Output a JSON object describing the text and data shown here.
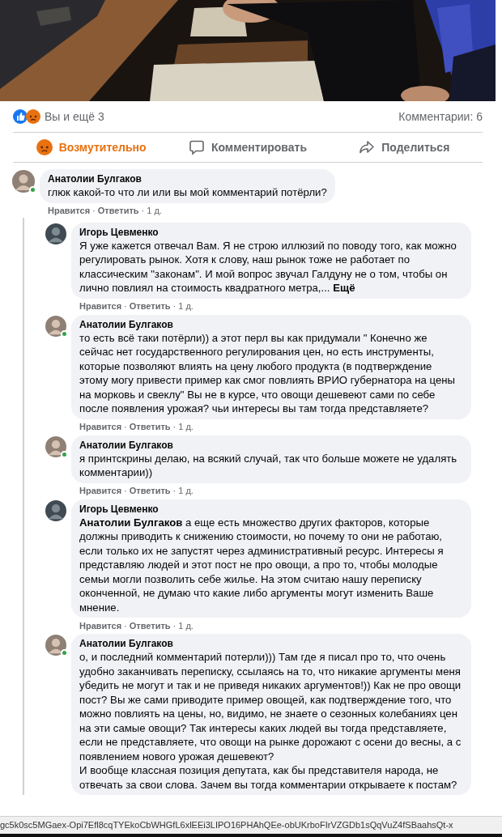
{
  "meta_separator": "·",
  "reactions": {
    "summary": "Вы и ещё 3",
    "comments_count": "Комментарии: 6"
  },
  "actions": [
    {
      "kind": "angry",
      "label": "Возмутительно",
      "selected": true
    },
    {
      "kind": "comment",
      "label": "Комментировать",
      "selected": false
    },
    {
      "kind": "share",
      "label": "Поделиться",
      "selected": false
    }
  ],
  "comments": [
    {
      "author": "Анатолии Булгаков",
      "online": true,
      "text": "глюк какой-то что ли или вы мой комментарий потёрли?",
      "like": "Нравится",
      "reply": "Ответить",
      "time": "1 д.",
      "children": [
        {
          "author": "Игорь Цевменко",
          "online": false,
          "text": "Я уже кажется отвечал Вам. Я не строю иллюзий по поводу того, как можно регулировать рынок. Хотя к слову, наш рынок тоже не работает по классическим \"законам\". И мой вопрос звучал Галдуну не о том, чтобы он лично повлиял на стоимость квадратного метра,...",
          "more": "Ещё",
          "like": "Нравится",
          "reply": "Ответить",
          "time": "1 д."
        },
        {
          "author": "Анатолии Булгаков",
          "online": true,
          "text": "то есть всё таки потёрли)) а этот перл вы как придумали \" Конечно же сейчас нет государственного регулирования цен, но есть инструменты, которые позволяют влиять на цену любого продукта (в подтверждение этому могу привести пример как смог повлиять ВРИО губернатора на цены на морковь и свеклу\" Вы не в курсе, что овощи дешевеют сами по себе после появления урожая? чьи интересы вы там тогда представляете?",
          "like": "Нравится",
          "reply": "Ответить",
          "time": "1 д."
        },
        {
          "author": "Анатолии Булгаков",
          "online": true,
          "text": "я принтскрины делаю, на всякий случай, так что больше можете не удалять комментарии))",
          "like": "Нравится",
          "reply": "Ответить",
          "time": "1 д."
        },
        {
          "author": "Игорь Цевменко",
          "online": false,
          "text": "**Анатолии Булгаков** а еще есть множество других факторов, которые должны приводить к снижению стоимости, но почему то они не работаю, если только их не запустят через административный ресурс. Интересы я представляю людей и этот пост не про овощи, а про то, чтобы молодые семьи могли позволить себе жилье. На этом считаю нашу переписку оконченной, не думаю что какие либо аргументы могут изменить Ваше мнение.",
          "like": "Нравится",
          "reply": "Ответить",
          "time": "1 д."
        },
        {
          "author": "Анатолии Булгаков",
          "online": true,
          "text": "о, и последний комментарий потерли))) Там где я писал про то, что очень удобно заканчивать переписку, ссылаясь на то, что никакие аргументы меня убедить не могут и так и не приведя никаких аргументов!)) Как не про овощи пост? Вы же сами приводите пример овощей, как подтверждение того, что можно повлиять на цены, но, видимо, не знаете о сезонных колебаниях цен на эти самые овощи? Так интересы каких людей вы тогда представляете, если не представляете, что овощи на рынке дорожают с осени до весны, а с появлением нового урожая дешевеют?\nИ вообще классная позиция депутата, как бы представителя народа, не отвечать за свои слова. Зачем вы тогда комментарии открываете к постам?"
        }
      ]
    }
  ],
  "status_bar": {
    "url": "gc5k0sc5MGaex-Opi7Efl8cqTYEkoCbWHGfL6xlEEi3LIPO16PHAhQEe-obUKrboFIrVZGDb1sQqVuZ4fSBaahsQt-x"
  }
}
